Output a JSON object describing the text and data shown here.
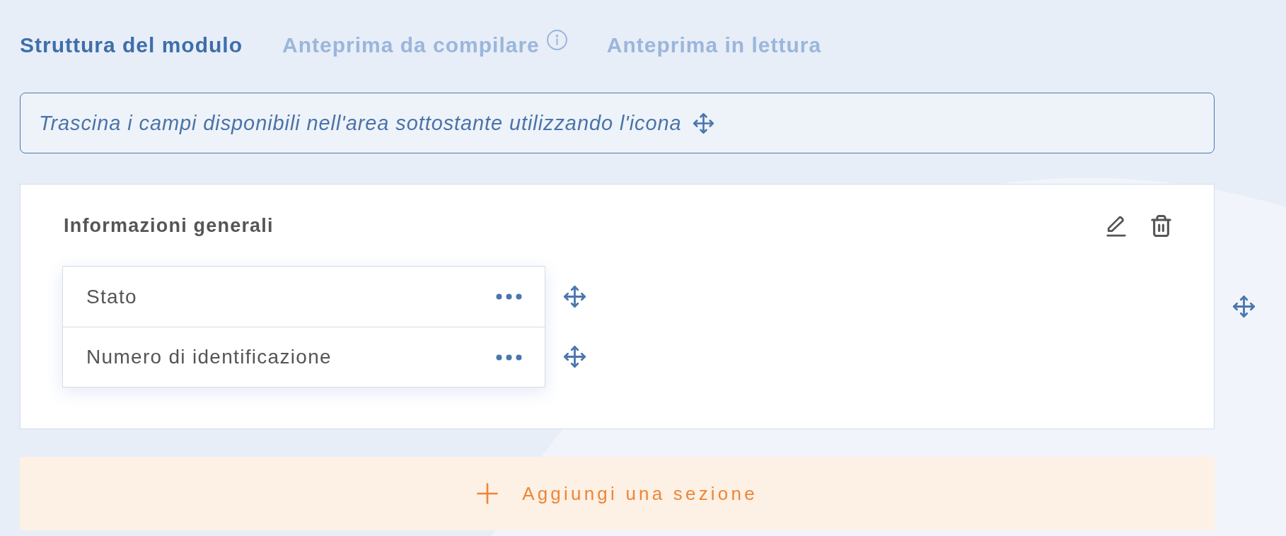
{
  "tabs": [
    {
      "label": "Struttura del modulo",
      "selected": true,
      "info_icon": false
    },
    {
      "label": "Anteprima da compilare",
      "selected": false,
      "info_icon": true
    },
    {
      "label": "Anteprima in lettura",
      "selected": false,
      "info_icon": false
    }
  ],
  "hint": {
    "text": "Trascina i campi disponibili nell'area sottostante utilizzando l'icona"
  },
  "sections": [
    {
      "title": "Informazioni generali",
      "fields": [
        {
          "label": "Stato"
        },
        {
          "label": "Numero di identificazione"
        }
      ]
    }
  ],
  "add_section_button": {
    "label": "Aggiungi una sezione"
  }
}
